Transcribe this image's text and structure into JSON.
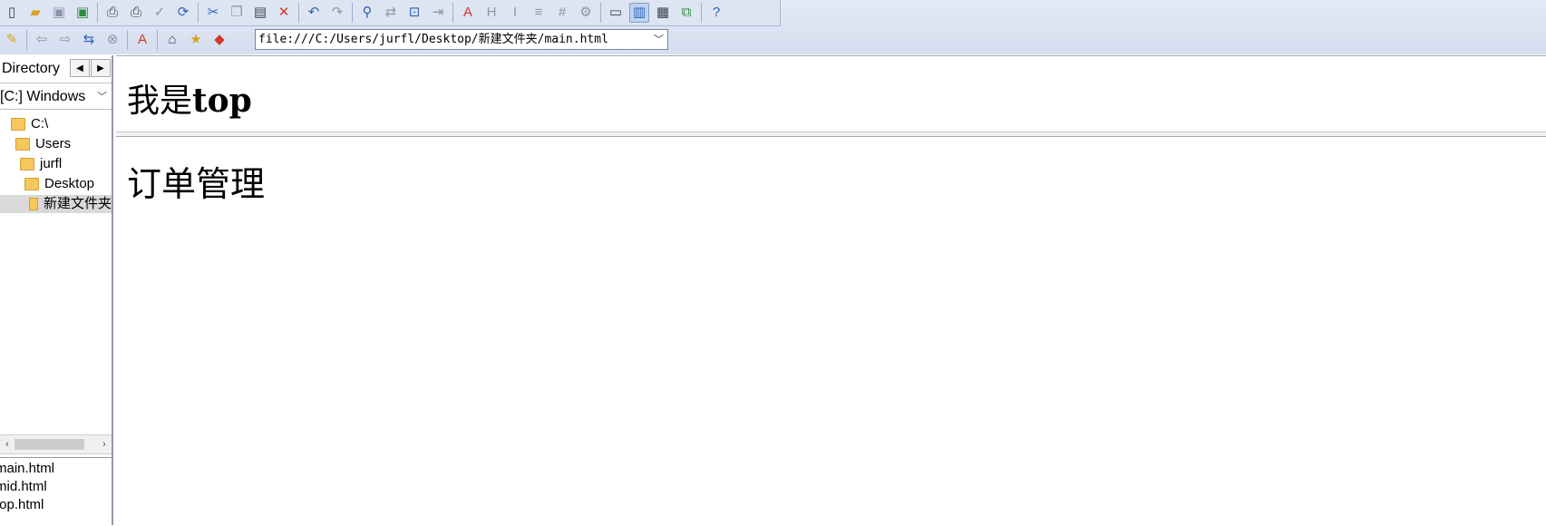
{
  "toolbar": {
    "row1_icons": [
      "new-file-icon",
      "open-folder-icon",
      "save-icon",
      "save-all-icon",
      "print-preview-icon",
      "print-icon",
      "spell-check-icon",
      "refresh-icon",
      "cut-icon",
      "copy-icon",
      "paste-icon",
      "delete-icon",
      "undo-icon",
      "redo-icon",
      "find-icon",
      "replace-icon",
      "goto-icon",
      "indent-icon",
      "font-icon",
      "heading-icon",
      "italic-icon",
      "outdent-icon",
      "numbering-icon",
      "settings-icon",
      "normal-view-icon",
      "split-view-icon",
      "preview-view-icon",
      "external-view-icon",
      "help-icon"
    ],
    "row2_icons": [
      "edit-pencil-icon",
      "back-icon",
      "forward-icon",
      "reload-icon",
      "stop-icon",
      "validate-icon",
      "home-icon",
      "favorites-icon",
      "bookmark-icon"
    ]
  },
  "address": {
    "value": "file:///C:/Users/jurfl/Desktop/新建文件夹/main.html"
  },
  "sidebar": {
    "title": "Directory",
    "drive": "[C:] Windows",
    "tree": [
      {
        "label": "C:\\",
        "indent": 0
      },
      {
        "label": "Users",
        "indent": 1
      },
      {
        "label": "jurfl",
        "indent": 2
      },
      {
        "label": "Desktop",
        "indent": 3
      },
      {
        "label": "新建文件夹",
        "indent": 4,
        "selected": true
      }
    ],
    "files": [
      "main.html",
      "mid.html",
      "top.html"
    ]
  },
  "content": {
    "top_frame_prefix": "我是",
    "top_frame_suffix": "top",
    "main_heading": "订单管理"
  }
}
